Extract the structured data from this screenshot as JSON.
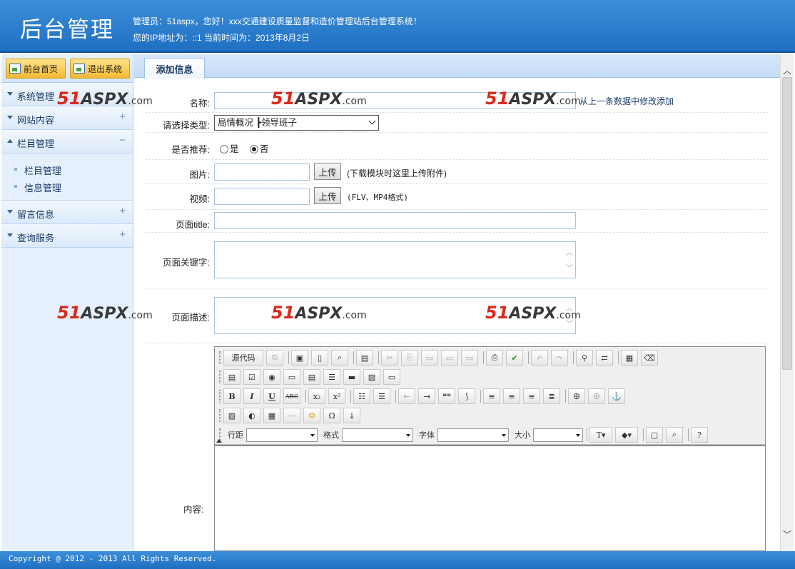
{
  "header": {
    "title": "后台管理",
    "welcome": "管理员：51aspx，您好！xxx交通建设质量监督和造价管理站后台管理系统！",
    "ip_line": "您的IP地址为：::1 当前时间为：2013年8月2日"
  },
  "sidebar": {
    "home_button": "前台首页",
    "logout_button": "退出系统",
    "menus": [
      {
        "label": "系统管理",
        "toggle": ""
      },
      {
        "label": "网站内容",
        "toggle": "+"
      },
      {
        "label": "栏目管理",
        "toggle": "−"
      },
      {
        "label": "留言信息",
        "toggle": "+"
      },
      {
        "label": "查询服务",
        "toggle": "+"
      }
    ],
    "submenu": [
      "栏目管理",
      "信息管理"
    ]
  },
  "main": {
    "tab": "添加信息",
    "form": {
      "name_label": "名称:",
      "name_hint": "从上一条数据中修改添加",
      "type_label": "请选择类型:",
      "type_value": "局情概况    ┣领导班子",
      "recommend_label": "是否推荐:",
      "recommend_yes": "是",
      "recommend_no": "否",
      "image_label": "图片:",
      "image_upload": "上传",
      "image_hint": "(下载模块时这里上传附件)",
      "video_label": "视频:",
      "video_upload": "上传",
      "video_hint": "(FLV、MP4格式)",
      "title_label": "页面title:",
      "keywords_label": "页面关键字:",
      "description_label": "页面描述:",
      "content_label": "内容:"
    },
    "editor": {
      "source_button": "源代码",
      "combo_labels": [
        "行距",
        "格式",
        "字体",
        "大小"
      ],
      "bold": "B",
      "italic": "I",
      "underline": "U",
      "strike": "ABC",
      "subscript": "x₂",
      "superscript": "x²",
      "quote": "❝❝"
    }
  },
  "watermark": {
    "num": "51",
    "brand": "ASPX",
    "tld": ".com"
  },
  "footer": {
    "copyright": "Copyright @ 2012 - 2013 All Rights Reserved."
  }
}
